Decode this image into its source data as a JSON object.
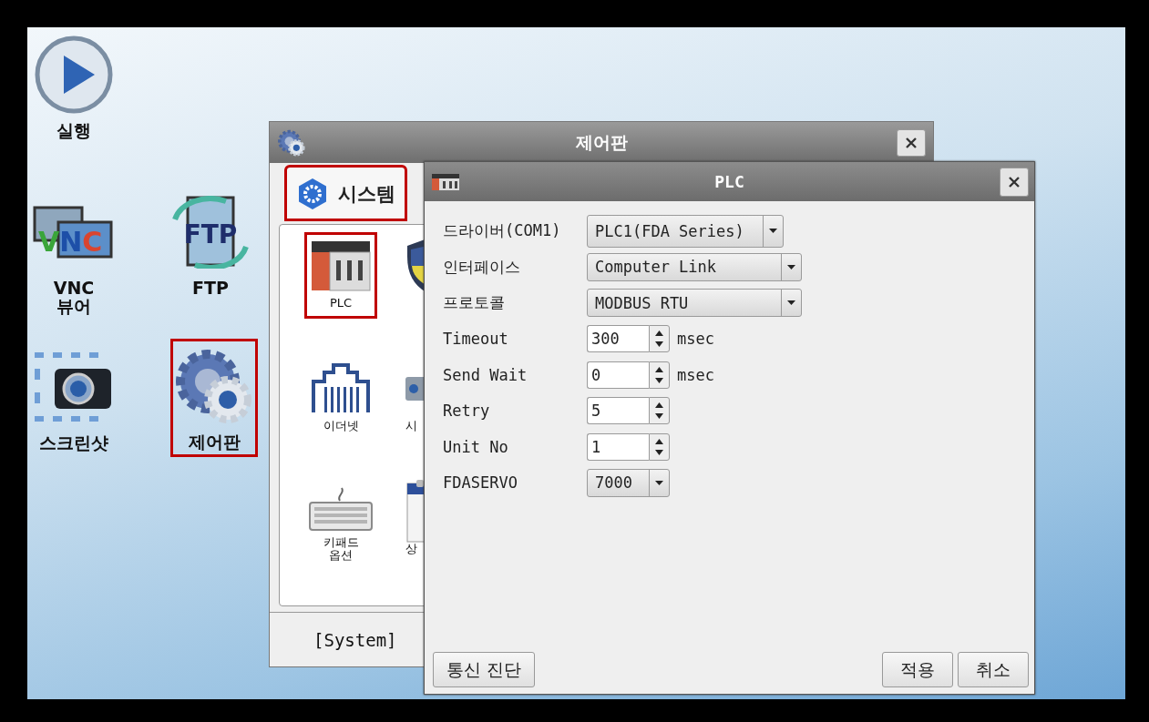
{
  "desktop_icons": [
    {
      "label": "실행",
      "kind": "play",
      "highlighted": false
    },
    {
      "label": "VNC\n뷰어",
      "kind": "vnc",
      "icon_text": "VNC",
      "highlighted": false
    },
    {
      "label": "FTP",
      "kind": "ftp",
      "icon_text": "FTP",
      "highlighted": false
    },
    {
      "label": "스크린샷",
      "kind": "camera",
      "highlighted": false
    },
    {
      "label": "제어판",
      "kind": "gears",
      "highlighted": true
    }
  ],
  "control_panel": {
    "title": "제어판",
    "tabs": [
      {
        "label": "시스템",
        "selected": true,
        "highlighted": true
      }
    ],
    "items": [
      {
        "label": "PLC",
        "kind": "plc",
        "highlighted": true
      },
      {
        "kind": "shield",
        "highlighted": false
      },
      {
        "label": "이더넷",
        "kind": "ethernet",
        "highlighted": false
      },
      {
        "label": "시",
        "kind": "device",
        "highlighted": false
      },
      {
        "label": "키패드\n옵션",
        "kind": "keyboard",
        "highlighted": false
      },
      {
        "label": "상",
        "kind": "calendar",
        "highlighted": false
      }
    ],
    "status": "[System]"
  },
  "plc_dialog": {
    "title": "PLC",
    "fields": [
      {
        "label": "드라이버(COM1)",
        "kind": "dropdown",
        "value": "PLC1(FDA Series)"
      },
      {
        "label": "인터페이스",
        "kind": "dropdown",
        "value": "Computer Link"
      },
      {
        "label": "프로토콜",
        "kind": "dropdown",
        "value": "MODBUS RTU"
      },
      {
        "label": "Timeout",
        "kind": "spin",
        "value": "300",
        "unit": "msec"
      },
      {
        "label": "Send Wait",
        "kind": "spin",
        "value": "0",
        "unit": "msec"
      },
      {
        "label": "Retry",
        "kind": "spin",
        "value": "5"
      },
      {
        "label": "Unit No",
        "kind": "spin",
        "value": "1"
      },
      {
        "label": "FDASERVO",
        "kind": "dropdown",
        "value": "7000"
      }
    ],
    "left_buttons": [
      "통신 진단"
    ],
    "right_buttons": [
      "적용",
      "취소"
    ]
  }
}
